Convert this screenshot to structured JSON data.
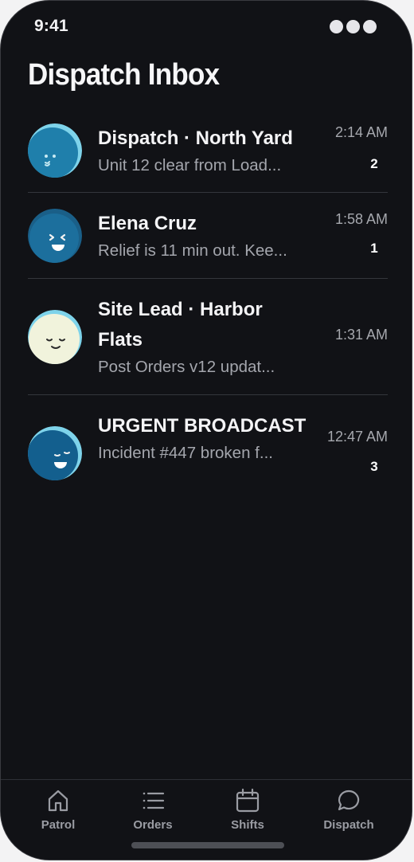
{
  "status_bar": {
    "time": "9:41"
  },
  "header": {
    "title": "Dispatch Inbox"
  },
  "conversations": [
    {
      "name": "Dispatch · North Yard",
      "preview": "Unit 12 clear from Load...",
      "time": "2:14 AM",
      "unread": "2",
      "avatar_color": "#1f7fab",
      "avatar_face": "smirk-wink"
    },
    {
      "name": "Elena Cruz",
      "preview": "Relief is 11 min out. Kee...",
      "time": "1:58 AM",
      "unread": "1",
      "avatar_color": "#1c6f9d",
      "avatar_face": "laughing"
    },
    {
      "name": "Site Lead · Harbor Flats",
      "preview": "Post Orders v12 updat...",
      "time": "1:31 AM",
      "unread": "",
      "avatar_color": "#f1f3dc",
      "avatar_face": "content"
    },
    {
      "name": "URGENT BROADCAST",
      "preview": "Incident #447 broken f...",
      "time": "12:47 AM",
      "unread": "3",
      "avatar_color": "#135f8e",
      "avatar_face": "grinning"
    }
  ],
  "tab_bar": {
    "tabs": [
      {
        "label": "Patrol",
        "icon": "home-icon"
      },
      {
        "label": "Orders",
        "icon": "list-icon"
      },
      {
        "label": "Shifts",
        "icon": "calendar-icon"
      },
      {
        "label": "Dispatch",
        "icon": "chat-bubble-icon"
      }
    ],
    "active": "Dispatch"
  },
  "colors": {
    "background": "#111216",
    "divider": "#34363c",
    "accent_avatar": "#7ed3ea"
  }
}
